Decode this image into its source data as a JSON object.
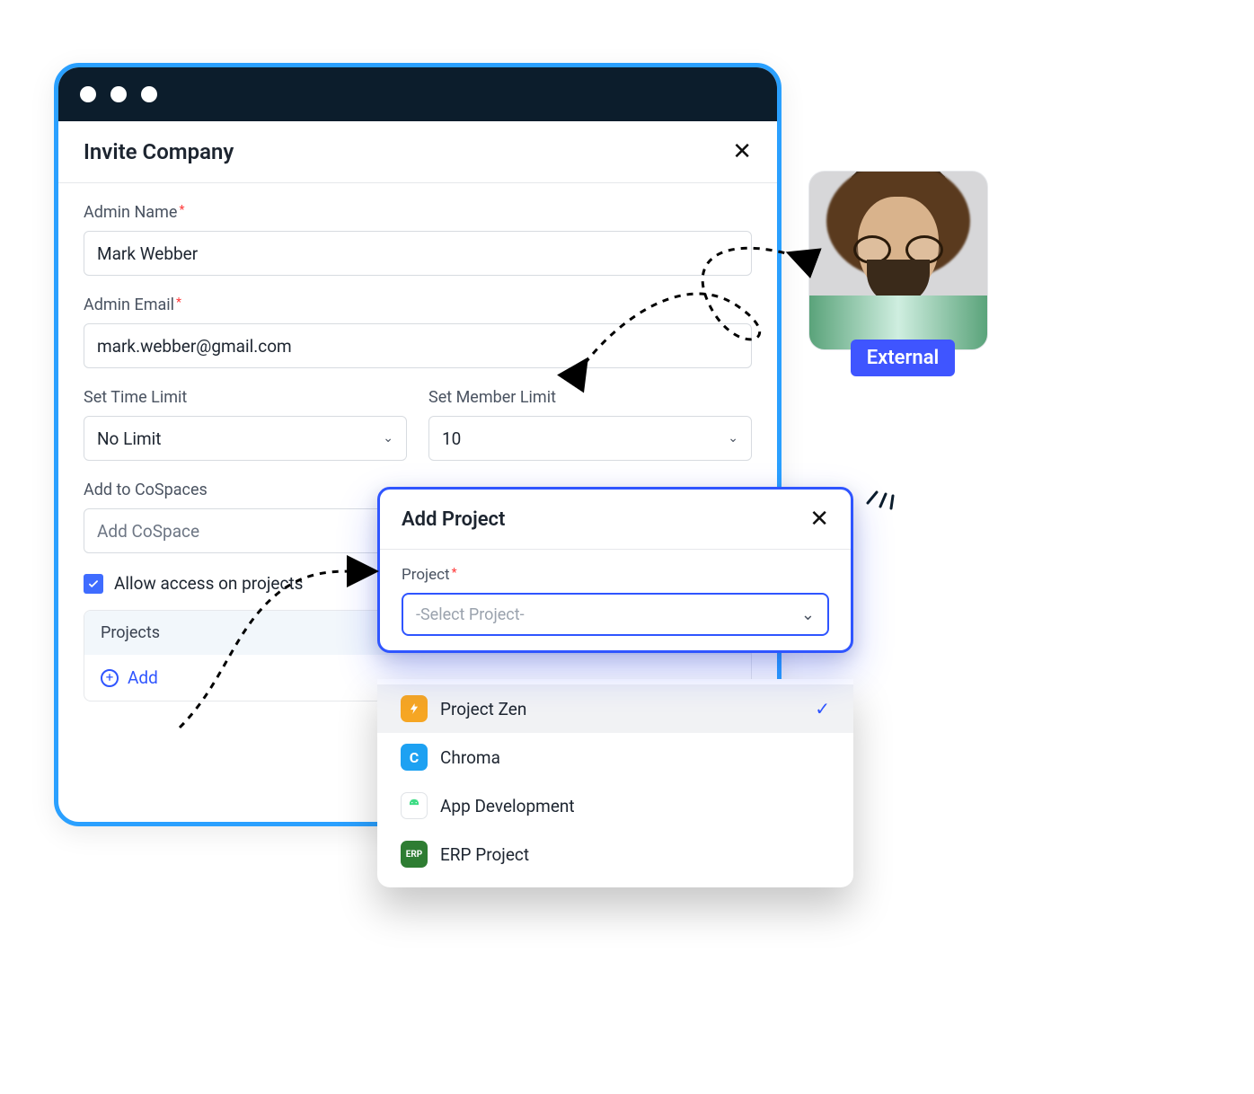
{
  "window": {},
  "dialog": {
    "title": "Invite Company",
    "fields": {
      "admin_name": {
        "label": "Admin Name",
        "value": "Mark Webber",
        "required": true
      },
      "admin_email": {
        "label": "Admin Email",
        "value": "mark.webber@gmail.com",
        "required": true
      },
      "time_limit": {
        "label": "Set Time Limit",
        "value": "No Limit"
      },
      "member_limit": {
        "label": "Set Member Limit",
        "value": "10"
      },
      "cospaces": {
        "label": "Add to CoSpaces",
        "placeholder": "Add CoSpace"
      }
    },
    "allow_projects": {
      "label": "Allow access on projects",
      "checked": true
    },
    "projects": {
      "header": "Projects",
      "add_label": "Add"
    }
  },
  "avatar": {
    "badge": "External"
  },
  "popover": {
    "title": "Add Project",
    "field_label": "Project",
    "placeholder": "-Select Project-",
    "options": [
      {
        "name": "Project Zen",
        "icon": "zen",
        "selected": true
      },
      {
        "name": "Chroma",
        "icon": "chroma",
        "selected": false
      },
      {
        "name": "App Development",
        "icon": "android",
        "selected": false
      },
      {
        "name": "ERP Project",
        "icon": "erp",
        "selected": false
      }
    ]
  }
}
